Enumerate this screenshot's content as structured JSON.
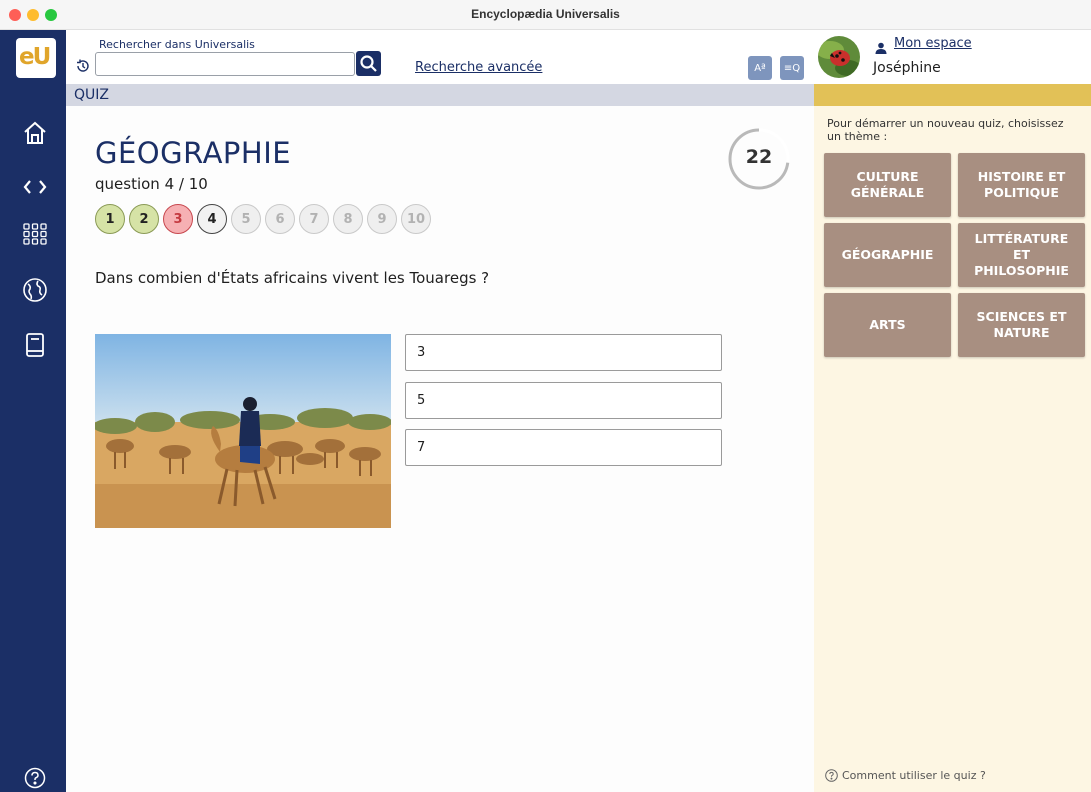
{
  "window": {
    "title": "Encyclopædia Universalis"
  },
  "sidebar": {
    "logo_text": "eU",
    "items": [
      {
        "name": "home-icon"
      },
      {
        "name": "code-icon"
      },
      {
        "name": "grid-icon"
      },
      {
        "name": "globe-icon"
      },
      {
        "name": "book-icon"
      }
    ],
    "help_icon": "help-icon"
  },
  "search": {
    "label": "Rechercher dans Universalis",
    "value": "",
    "advanced_label": "Recherche avancée"
  },
  "tools": {
    "font_size_label": "Aª",
    "text_search_label": "≡Q"
  },
  "header": {
    "section_label": "QUIZ"
  },
  "quiz": {
    "title": "GÉOGRAPHIE",
    "progress_label": "question 4 / 10",
    "current_question": 4,
    "total_questions": 10,
    "question_markers": [
      {
        "number": "1",
        "state": "correct"
      },
      {
        "number": "2",
        "state": "correct"
      },
      {
        "number": "3",
        "state": "wrong"
      },
      {
        "number": "4",
        "state": "current"
      },
      {
        "number": "5",
        "state": "pending"
      },
      {
        "number": "6",
        "state": "pending"
      },
      {
        "number": "7",
        "state": "pending"
      },
      {
        "number": "8",
        "state": "pending"
      },
      {
        "number": "9",
        "state": "pending"
      },
      {
        "number": "10",
        "state": "pending"
      }
    ],
    "timer_value": "22",
    "timer_fraction": 0.73,
    "question": "Dans combien d'États africains vivent les Touaregs ?",
    "answers": [
      "3",
      "5",
      "7"
    ]
  },
  "user": {
    "account_link": "Mon espace",
    "name": "Joséphine"
  },
  "themes_panel": {
    "intro": "Pour démarrer un nouveau quiz, choisissez un thème :",
    "themes": [
      "CULTURE GÉNÉRALE",
      "HISTOIRE ET POLITIQUE",
      "GÉOGRAPHIE",
      "LITTÉRATURE ET PHILOSOPHIE",
      "ARTS",
      "SCIENCES ET NATURE"
    ],
    "help_link": "Comment utiliser le quiz ?"
  },
  "colors": {
    "navy": "#1b2f66",
    "theme_button": "#a88f81",
    "panel_bg": "#fdf6e3",
    "gold_strip": "#e2c157",
    "correct": "#d6e3a6",
    "wrong": "#f6b0b3"
  }
}
